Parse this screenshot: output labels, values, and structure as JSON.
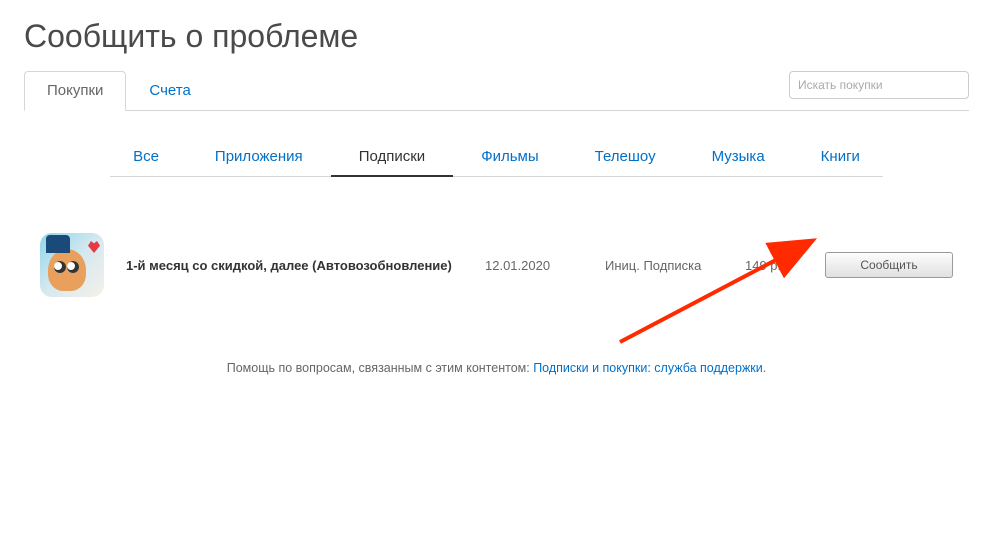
{
  "page": {
    "title": "Сообщить о проблеме"
  },
  "search": {
    "placeholder": "Искать покупки"
  },
  "primaryTabs": [
    {
      "label": "Покупки",
      "active": true
    },
    {
      "label": "Счета",
      "active": false
    }
  ],
  "subTabs": [
    {
      "label": "Все",
      "active": false
    },
    {
      "label": "Приложения",
      "active": false
    },
    {
      "label": "Подписки",
      "active": true
    },
    {
      "label": "Фильмы",
      "active": false
    },
    {
      "label": "Телешоу",
      "active": false
    },
    {
      "label": "Музыка",
      "active": false
    },
    {
      "label": "Книги",
      "active": false
    }
  ],
  "item": {
    "name": "1-й месяц со скидкой, далее (Автовозобновление)",
    "date": "12.01.2020",
    "type": "Иниц. Подписка",
    "price": "149 р.",
    "button": "Сообщить"
  },
  "help": {
    "prefix": "Помощь по вопросам, связанным с этим контентом: ",
    "link": "Подписки и покупки: служба поддержки",
    "suffix": "."
  }
}
